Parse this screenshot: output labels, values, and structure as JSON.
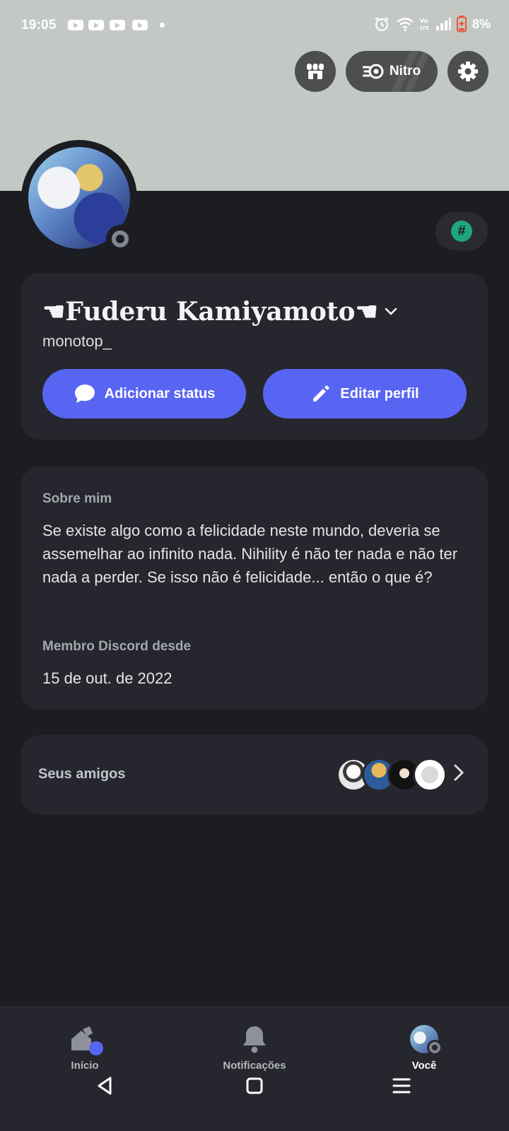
{
  "status_bar": {
    "time": "19:05",
    "battery": "8%",
    "icons": [
      "youtube-icon",
      "youtube-icon",
      "youtube-icon",
      "youtube-icon",
      "alarm-icon",
      "wifi-icon",
      "volte-icon",
      "signal-icon",
      "battery-icon"
    ]
  },
  "top_actions": {
    "nitro_label": "Nitro",
    "icons": [
      "shop-icon",
      "nitro-icon",
      "gear-icon"
    ]
  },
  "profile": {
    "display_name": "☚Fuderu Kamiyamoto☚",
    "username": "monotop_",
    "badge_symbol": "#",
    "add_status_label": "Adicionar status",
    "edit_profile_label": "Editar perfil"
  },
  "about": {
    "label": "Sobre mim",
    "text": "Se existe algo como a felicidade neste mundo, deveria se assemelhar ao infinito nada. Nihility é não ter nada e não ter nada a perder. Se isso não é felicidade... então o que é?",
    "member_label": "Membro Discord desde",
    "member_date": "15 de out. de 2022"
  },
  "friends": {
    "label": "Seus amigos",
    "avatar_count": 4
  },
  "bottom_nav": {
    "items": [
      {
        "label": "Início"
      },
      {
        "label": "Notificações"
      },
      {
        "label": "Você"
      }
    ]
  },
  "colors": {
    "accent": "#5865f2",
    "background": "#1c1d22",
    "card": "#26272e",
    "banner": "#c4c8c4",
    "online_badge": "#1ea67d"
  }
}
